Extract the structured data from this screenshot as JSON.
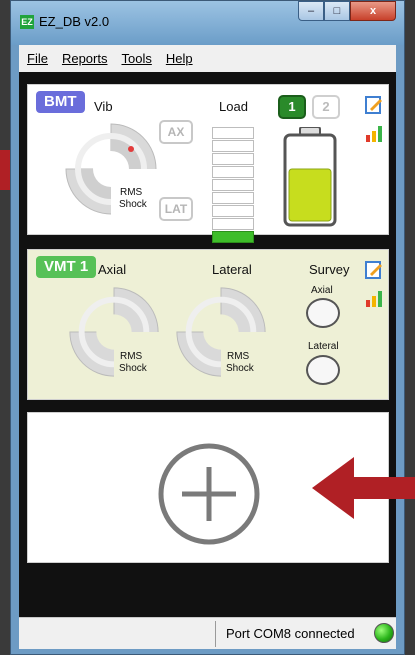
{
  "window": {
    "app_icon": "EZ",
    "title": "EZ_DB v2.0",
    "controls": {
      "minimize": "–",
      "maximize": "□",
      "close": "x"
    }
  },
  "menu": [
    {
      "label": "File"
    },
    {
      "label": "Reports"
    },
    {
      "label": "Tools"
    },
    {
      "label": "Help"
    }
  ],
  "bmt": {
    "tag": "BMT",
    "vib_label": "Vib",
    "gauge_rms": "RMS",
    "gauge_shock": "Shock",
    "ax_button": "AX",
    "lat_button": "LAT",
    "load_label": "Load",
    "load_segments_total": 9,
    "load_segments_on": 1,
    "battery_level": 0.62,
    "button_1": "1",
    "button_2": "2",
    "edit_icon": "edit-icon",
    "chart_icon": "bar-chart-icon"
  },
  "vmt": {
    "tag": "VMT 1",
    "axial_label": "Axial",
    "lateral_label": "Lateral",
    "axial_rms": "RMS",
    "axial_shock": "Shock",
    "lateral_rms": "RMS",
    "lateral_shock": "Shock",
    "survey_label": "Survey",
    "survey_axial": "Axial",
    "survey_lateral": "Lateral",
    "edit_icon": "edit-icon",
    "chart_icon": "bar-chart-icon"
  },
  "add_panel": {
    "icon": "add-icon",
    "arrow": "arrow-left-icon"
  },
  "status": {
    "text": "Port COM8 connected",
    "light_color": "#2bb51b"
  },
  "colors": {
    "bmt_tag": "#6a6ddb",
    "vmt_tag": "#57c157",
    "arrow": "#b02025"
  }
}
